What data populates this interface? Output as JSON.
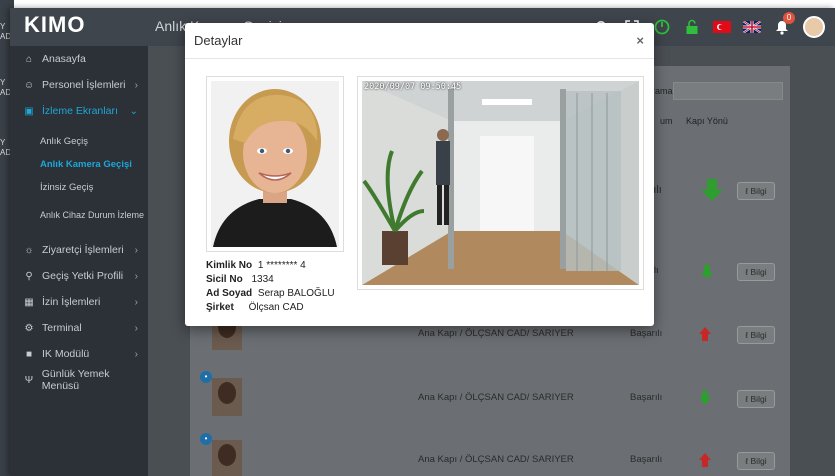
{
  "app": {
    "logo": "KIMO",
    "page_title": "Anlık Kamera Geçişi"
  },
  "bg_strip_texts": [
    "Y",
    "AD",
    "Y",
    "AD",
    "Y",
    "AD"
  ],
  "topbar": {
    "icons": [
      "search-icon",
      "expand-icon",
      "power-icon",
      "lock-icon",
      "flag-tr-icon",
      "flag-uk-icon",
      "bell-icon",
      "user-avatar"
    ],
    "notification_count": "0"
  },
  "sidebar": {
    "items": [
      {
        "label": "Anasayfa",
        "icon": "home-icon"
      },
      {
        "label": "Personel İşlemleri",
        "icon": "users-icon"
      },
      {
        "label": "İzleme Ekranları",
        "icon": "monitor-icon"
      },
      {
        "label": "Ziyaretçi İşlemleri",
        "icon": "visitor-icon"
      },
      {
        "label": "Geçiş Yetki Profili",
        "icon": "key-icon"
      },
      {
        "label": "İzin İşlemleri",
        "icon": "calendar-icon"
      },
      {
        "label": "Terminal",
        "icon": "gear-icon"
      },
      {
        "label": "IK Modülü",
        "icon": "chat-icon"
      },
      {
        "label": "Günlük Yemek Menüsü",
        "icon": "food-icon"
      }
    ],
    "subitems": [
      {
        "label": "Anlık Geçiş"
      },
      {
        "label": "Anlık Kamera Geçişi"
      },
      {
        "label": "İzinsiz Geçiş"
      },
      {
        "label": "Anlık Cihaz Durum İzleme"
      }
    ]
  },
  "table": {
    "search_label": "Arama:",
    "col_kapi_yonu": "Kapı Yönü",
    "col_durum": "um",
    "rows": [
      {
        "door": "",
        "status": "şarılı",
        "info": "Bilgi",
        "direction": "in"
      },
      {
        "door": "",
        "status": "şarılı",
        "info": "Bilgi",
        "direction": "in"
      },
      {
        "door": "Ana Kapı / ÖLÇSAN CAD/ SARIYER",
        "status": "Başarılı",
        "info": "Bilgi",
        "direction": "out"
      },
      {
        "door": "Ana Kapı / ÖLÇSAN CAD/ SARIYER",
        "status": "Başarılı",
        "info": "Bilgi",
        "direction": "in"
      },
      {
        "door": "Ana Kapı / ÖLÇSAN CAD/ SARIYER",
        "status": "Başarılı",
        "info": "Bilgi",
        "direction": "out"
      }
    ]
  },
  "modal": {
    "title": "Detaylar",
    "close": "×",
    "camera_timestamp": "2020/09/07 09:50:45",
    "kimlik_label": "Kimlik No",
    "kimlik_value": "1 ******** 4",
    "sicil_label": "Sicil No",
    "sicil_value": "1334",
    "adsoyad_label": "Ad Soyad",
    "adsoyad_value": "Serap BALOĞLU",
    "sirket_label": "Şirket",
    "sirket_value": "Ölçsan CAD"
  },
  "colors": {
    "accent": "#1ea7d8",
    "arrow_in": "#2e9e2e",
    "arrow_out": "#c62828"
  }
}
